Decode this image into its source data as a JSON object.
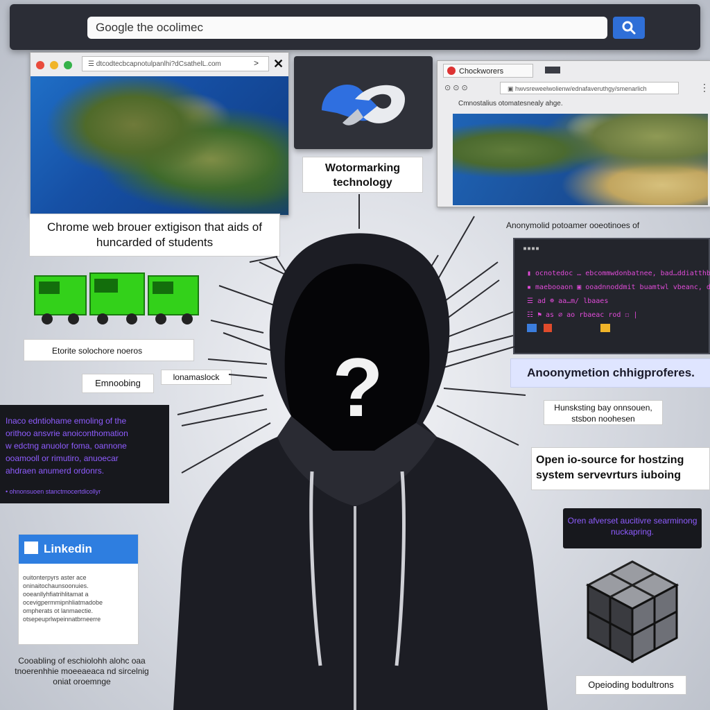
{
  "search": {
    "value": "Google the ocolimec"
  },
  "left_window": {
    "url": "☰ dtcodtecbcapnotulpanlhi?dCsathelL.com",
    "caption": "Chrome web brouer extigison that aids of huncarded of  students"
  },
  "center_card": {
    "label": "Wotormarking technology"
  },
  "right_window": {
    "tab_label": "Chockworers",
    "url": "▣ hwvsreweelwolienw/ednafaveruthgy/smenarlich",
    "subtitle": "Cmnostalius otomatesnealy ahge."
  },
  "terminal": {
    "title": "Anonymolid potoamer ooeotinoes of",
    "lines": [
      "▮  ocnotedoc  …  ebcommwdonbatnee, bad…ddiatthbe",
      "▪ maebooaon ▣ ooadnnoddmit  buamtwl vbeanc, dsenaha",
      "        ☰ ad ☸ aa…m/ lbaaes",
      "  ☷  ⚑  as  ⌀ ao  rbaeac rod ☐  |"
    ]
  },
  "anon_label": "Anoonymetion chhigproferes.",
  "etorite_label": "Etorite solochore noeros",
  "embedding_label": "Emnoobing",
  "ionamaslock_label": "lonamaslock",
  "dark_panel_left": {
    "lines": [
      "Inaco edntiohame emoling of the",
      "orithoo ansvrie anoiconthomation",
      "w edctng anuolor foma, oannone",
      "ooamooll or rimutiro, anuoecar",
      "ahdraen anumerd ordonrs."
    ],
    "foot": "• ohnonsuoen stanctmocertdicollyr"
  },
  "hobstaling_label": "Hunsksting bay onnsouen, stsbon noohesen",
  "opensource_label": "Open io-source for hostzing system servevrturs iuboing",
  "dark_panel_right": "Oren afverset aucitivre searminong nuckapring.",
  "linkedin": {
    "title": "Linkedin",
    "body": [
      "ouitonterpyrs aster ace",
      "oninaitochaunsoonuies.",
      "ooeanllyhfiatrihlitamat a",
      "ocevigpermmipnhliatmadobe",
      "ompherats ot lanmaectie.",
      "otsepeuprlwpeinnatbrneerre"
    ]
  },
  "bottom_left_text": "Cooabling of eschiolohh alohc oaa tnoerenhhie moeeaeaca nd sircelnig oniat oroemnge",
  "cube_label": "Opeioding bodultrons",
  "colors": {
    "search_button": "#2f6fd7",
    "linkedin_blue": "#2e7ee0",
    "terminal_purple": "#8f5cff",
    "terminal_magenta": "#e04bd8",
    "truck_green": "#33d11a"
  },
  "icons": [
    "search-icon",
    "cloud-logo-icon",
    "question-mark-icon",
    "cube-icon",
    "truck-icon",
    "close-icon"
  ]
}
